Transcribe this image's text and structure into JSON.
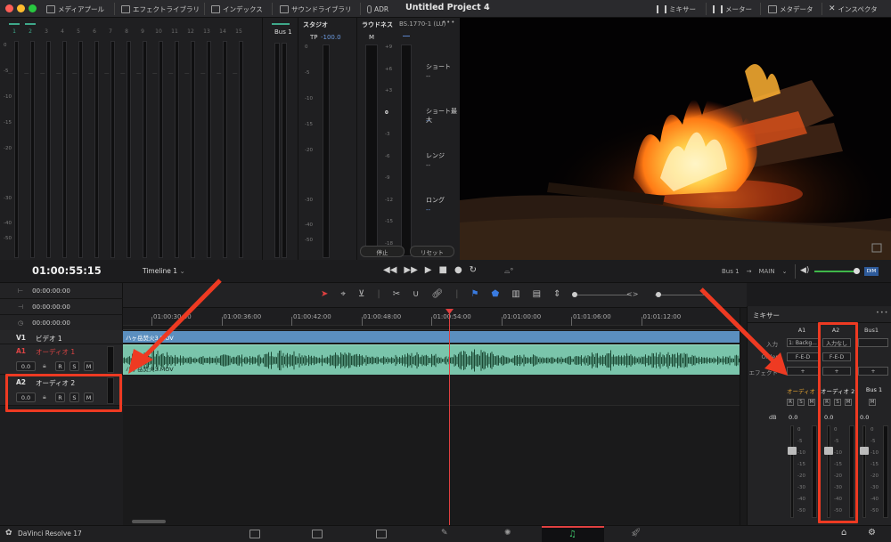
{
  "window": {
    "title": "Untitled Project 4"
  },
  "topbar": {
    "media_pool": "メディアプール",
    "effects_library": "エフェクトライブラリ",
    "index": "インデックス",
    "sound_library": "サウンドライブラリ",
    "adr": "ADR",
    "mixer": "ミキサー",
    "meters": "メーター",
    "metadata": "メタデータ",
    "inspector": "インスペクタ"
  },
  "meters": {
    "channel_numbers": [
      "1",
      "2",
      "3",
      "4",
      "5",
      "6",
      "7",
      "8",
      "9",
      "10",
      "11",
      "12",
      "13",
      "14",
      "15"
    ],
    "ticks": [
      "0",
      "-5",
      "-10",
      "-15",
      "-20",
      "-30",
      "-40",
      "-50"
    ],
    "bus_label": "Bus 1",
    "studio": {
      "title": "スタジオ",
      "tp_label": "TP",
      "tp_value": "-100.0"
    },
    "loudness": {
      "title": "ラウドネス",
      "standard": "BS.1770-1 (LU)",
      "m_label": "M",
      "scale": [
        "+9",
        "+6",
        "+3",
        "0",
        "-3",
        "-6",
        "-9",
        "-12",
        "-15",
        "-18"
      ],
      "short": "ショート",
      "short_max": "ショート最大",
      "range": "レンジ",
      "long": "ロング",
      "dash": "--",
      "stop": "停止",
      "reset": "リセット"
    }
  },
  "transport": {
    "timecode": "01:00:55:15",
    "timeline_name": "Timeline 1",
    "output_bus": "Bus 1",
    "output_arrow": "→",
    "output_main": "MAIN",
    "dim": "DIM"
  },
  "timecodes": [
    "00:00:00:00",
    "00:00:00:00",
    "00:00:00:00"
  ],
  "tracks": {
    "v1": {
      "id": "V1",
      "name": "ビデオ 1"
    },
    "a1": {
      "id": "A1",
      "name": "オーディオ 1",
      "volume": "0.0"
    },
    "a2": {
      "id": "A2",
      "name": "オーディオ 2",
      "volume": "0.0"
    },
    "rsm": [
      "R",
      "S",
      "M"
    ]
  },
  "ruler": {
    "labels": [
      "01:00:30:00",
      "01:00:36:00",
      "01:00:42:00",
      "01:00:48:00",
      "01:00:54:00",
      "01:01:00:00",
      "01:01:06:00",
      "01:01:12:00"
    ]
  },
  "clips": {
    "video": "ハヶ岳焚火3.MOV",
    "audio": "ハヶ岳焚火3.MOV"
  },
  "mixer": {
    "title": "ミキサー",
    "columns": [
      "A1",
      "A2",
      "Bus1"
    ],
    "row_input": "入力",
    "row_order": "Order",
    "row_effects": "エフェクト",
    "a1_input": "1: Backg...",
    "a2_input": "入力なし",
    "order_value": "F-E-D",
    "plus": "+",
    "ch_names": [
      "オーディオ 1",
      "オーディオ 2",
      "Bus 1"
    ],
    "db_label": "dB",
    "level": "0.0",
    "scale": [
      "0",
      "-5",
      "-10",
      "-15",
      "-20",
      "-30",
      "-40",
      "-50"
    ]
  },
  "bottombar": {
    "app_name": "DaVinci Resolve 17"
  }
}
